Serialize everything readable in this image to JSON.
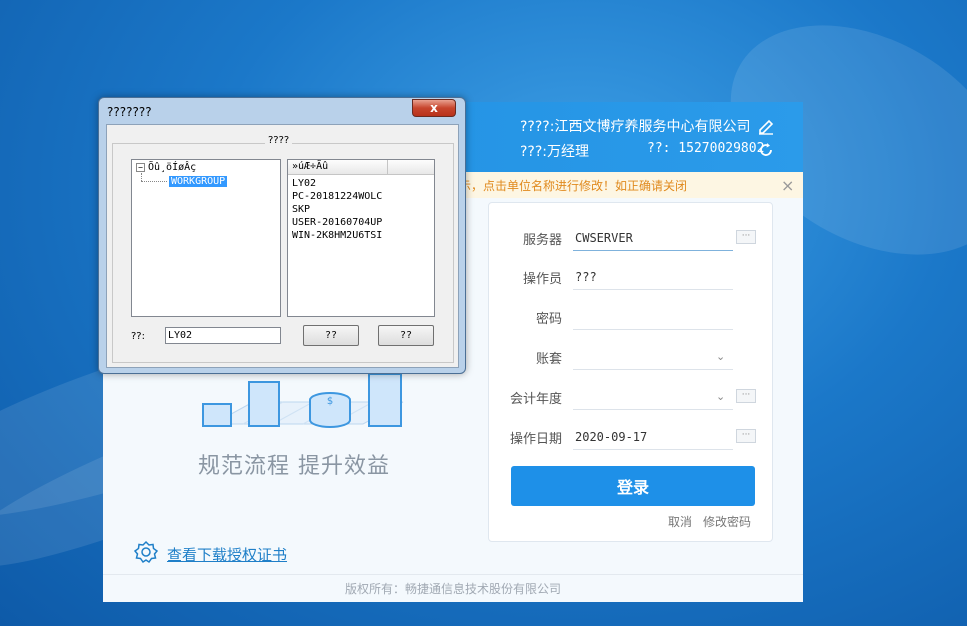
{
  "colors": {
    "header_blue": "#1f8ee0",
    "login_button": "#1e90e8",
    "notice_text": "#e08a1e",
    "link": "#1f7fc8"
  },
  "header": {
    "company_line": "????:江西文博疗养服务中心有限公司",
    "operator_line": "???:万经理",
    "phone_line": "??: 15270029802",
    "edit_icon": "pencil-icon",
    "refresh_icon": "refresh-icon"
  },
  "notice": {
    "text": "示，点击单位名称进行修改！如正确请关闭",
    "close": "×"
  },
  "hero": {
    "slogan": "规范流程  提升效益",
    "cert_link": "查看下载授权证书",
    "cert_icon": "badge-icon"
  },
  "footer": {
    "copyright": "版权所有：畅捷通信息技术股份有限公司"
  },
  "form": {
    "server_label": "服务器",
    "server_value": "CWSERVER",
    "operator_label": "操作员",
    "operator_value": "???",
    "password_label": "密码",
    "password_value": "",
    "account_label": "账套",
    "account_value": "",
    "fiscal_year_label": "会计年度",
    "fiscal_year_value": "",
    "op_date_label": "操作日期",
    "op_date_value": "2020-09-17",
    "more_button": "···",
    "dropdown_icon": "⌄",
    "login_label": "登录",
    "cancel_label": "取消",
    "change_password_label": "修改密码"
  },
  "dialog": {
    "title": "???????",
    "close": "x",
    "group_title": "????",
    "tree_toggle": "−",
    "tree_root": "Õû¸öÍøÂç",
    "tree_child": "WORKGROUP",
    "list_header": "»úÆ÷Ãû",
    "computers": [
      "LY02",
      "PC-20181224WOLC",
      "SKP",
      "USER-20160704UP",
      "WIN-2K8HM2U6TSI"
    ],
    "name_label": "??:",
    "name_value": "LY02",
    "ok_button": "??",
    "cancel_button": "??"
  }
}
